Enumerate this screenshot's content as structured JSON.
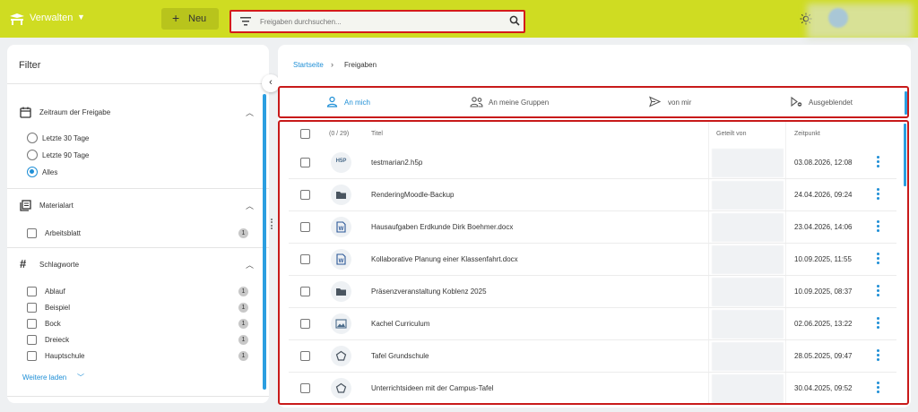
{
  "header": {
    "brand_label": "Verwalten",
    "new_label": "Neu",
    "search_placeholder": "Freigaben durchsuchen..."
  },
  "filter": {
    "title": "Filter",
    "period": {
      "heading": "Zeitraum der Freigabe",
      "options": [
        "Letzte 30 Tage",
        "Letzte 90 Tage",
        "Alles"
      ],
      "selected": "Alles"
    },
    "material": {
      "heading": "Materialart",
      "items": [
        {
          "label": "Arbeitsblatt",
          "count": "1"
        }
      ]
    },
    "tags": {
      "heading": "Schlagworte",
      "items": [
        {
          "label": "Ablauf",
          "count": "1"
        },
        {
          "label": "Beispiel",
          "count": "1"
        },
        {
          "label": "Bock",
          "count": "1"
        },
        {
          "label": "Dreieck",
          "count": "1"
        },
        {
          "label": "Hauptschule",
          "count": "1"
        }
      ]
    },
    "load_more": "Weitere laden"
  },
  "breadcrumb": {
    "home": "Startseite",
    "current": "Freigaben"
  },
  "tabs": [
    {
      "label": "An mich",
      "icon": "person-icon",
      "active": true
    },
    {
      "label": "An meine Gruppen",
      "icon": "group-icon",
      "active": false
    },
    {
      "label": "von mir",
      "icon": "send-icon",
      "active": false
    },
    {
      "label": "Ausgeblendet",
      "icon": "hidden-icon",
      "active": false
    }
  ],
  "table": {
    "columns": {
      "count": "(0 / 29)",
      "title": "Titel",
      "shared_by": "Geteilt von",
      "time": "Zeitpunkt"
    },
    "rows": [
      {
        "icon": "h5p-icon",
        "title": "testmarian2.h5p",
        "date": "03.08.2026, 12:08"
      },
      {
        "icon": "folder-icon",
        "title": "RenderingMoodle-Backup",
        "date": "24.04.2026, 09:24"
      },
      {
        "icon": "word-doc-icon",
        "title": "Hausaufgaben Erdkunde Dirk Boehmer.docx",
        "date": "23.04.2026, 14:06"
      },
      {
        "icon": "word-doc-icon",
        "title": "Kollaborative Planung einer Klassenfahrt.docx",
        "date": "10.09.2025, 11:55"
      },
      {
        "icon": "folder-icon",
        "title": "Präsenzveranstaltung Koblenz 2025",
        "date": "10.09.2025, 08:37"
      },
      {
        "icon": "image-icon",
        "title": "Kachel Curriculum",
        "date": "02.06.2025, 13:22"
      },
      {
        "icon": "tafel-icon",
        "title": "Tafel Grundschule",
        "date": "28.05.2025, 09:47"
      },
      {
        "icon": "tafel-icon",
        "title": "Unterrichtsideen mit der Campus-Tafel",
        "date": "30.04.2025, 09:52"
      }
    ]
  },
  "colors": {
    "topbar": "#cfdc22",
    "accent": "#1f8fd6",
    "highlight": "#c81a1a"
  }
}
